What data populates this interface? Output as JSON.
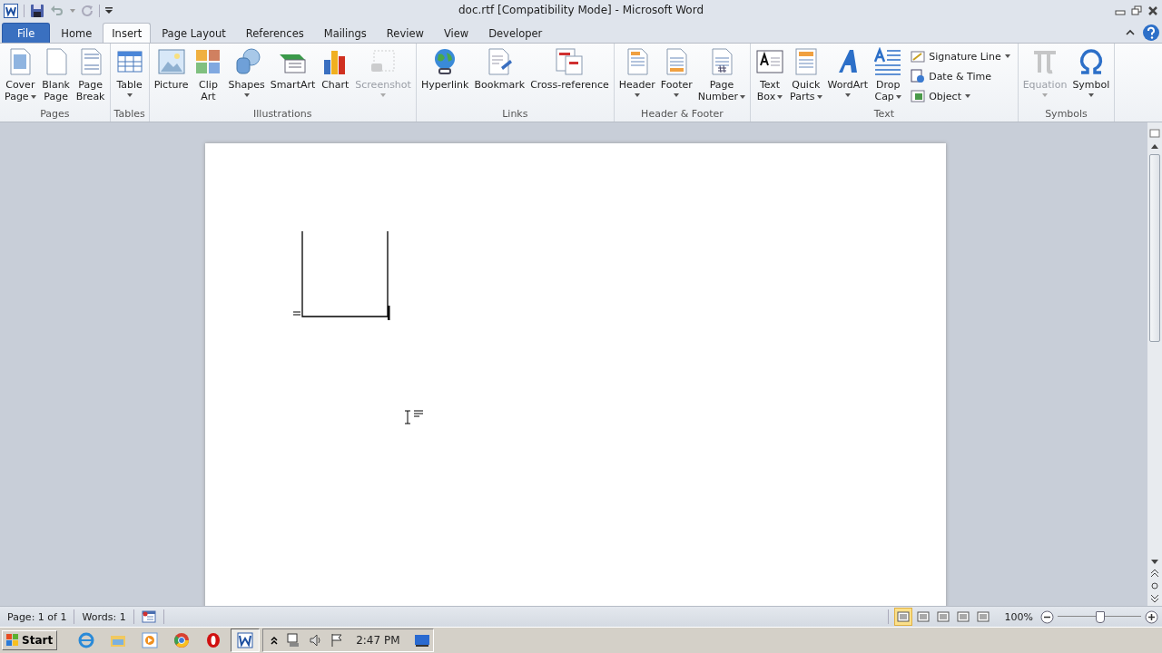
{
  "window": {
    "title": "doc.rtf [Compatibility Mode]  -  Microsoft Word"
  },
  "tabs": [
    {
      "label": "File",
      "kind": "file",
      "selected": false
    },
    {
      "label": "Home",
      "kind": "tab",
      "selected": false
    },
    {
      "label": "Insert",
      "kind": "tab",
      "selected": true
    },
    {
      "label": "Page Layout",
      "kind": "tab",
      "selected": false
    },
    {
      "label": "References",
      "kind": "tab",
      "selected": false
    },
    {
      "label": "Mailings",
      "kind": "tab",
      "selected": false
    },
    {
      "label": "Review",
      "kind": "tab",
      "selected": false
    },
    {
      "label": "View",
      "kind": "tab",
      "selected": false
    },
    {
      "label": "Developer",
      "kind": "tab",
      "selected": false
    }
  ],
  "ribbon_groups": [
    {
      "name": "Pages",
      "items": [
        {
          "kind": "large",
          "lines": [
            "Cover",
            "Page"
          ],
          "dropdown": true,
          "disabled": false
        },
        {
          "kind": "large",
          "lines": [
            "Blank",
            "Page"
          ],
          "dropdown": false,
          "disabled": false
        },
        {
          "kind": "large",
          "lines": [
            "Page",
            "Break"
          ],
          "dropdown": false,
          "disabled": false
        }
      ]
    },
    {
      "name": "Tables",
      "items": [
        {
          "kind": "large",
          "lines": [
            "Table"
          ],
          "dropdown": true,
          "disabled": false
        }
      ]
    },
    {
      "name": "Illustrations",
      "items": [
        {
          "kind": "large",
          "lines": [
            "Picture"
          ],
          "dropdown": false,
          "disabled": false
        },
        {
          "kind": "large",
          "lines": [
            "Clip",
            "Art"
          ],
          "dropdown": false,
          "disabled": false
        },
        {
          "kind": "large",
          "lines": [
            "Shapes"
          ],
          "dropdown": true,
          "disabled": false
        },
        {
          "kind": "large",
          "lines": [
            "SmartArt"
          ],
          "dropdown": false,
          "disabled": false
        },
        {
          "kind": "large",
          "lines": [
            "Chart"
          ],
          "dropdown": false,
          "disabled": false
        },
        {
          "kind": "large",
          "lines": [
            "Screenshot"
          ],
          "dropdown": true,
          "disabled": true
        }
      ]
    },
    {
      "name": "Links",
      "items": [
        {
          "kind": "large",
          "lines": [
            "Hyperlink"
          ],
          "dropdown": false,
          "disabled": false
        },
        {
          "kind": "large",
          "lines": [
            "Bookmark"
          ],
          "dropdown": false,
          "disabled": false
        },
        {
          "kind": "large",
          "lines": [
            "Cross-reference"
          ],
          "dropdown": false,
          "disabled": false
        }
      ]
    },
    {
      "name": "Header & Footer",
      "items": [
        {
          "kind": "large",
          "lines": [
            "Header"
          ],
          "dropdown": true,
          "disabled": false
        },
        {
          "kind": "large",
          "lines": [
            "Footer"
          ],
          "dropdown": true,
          "disabled": false
        },
        {
          "kind": "large",
          "lines": [
            "Page",
            "Number"
          ],
          "dropdown": true,
          "disabled": false
        }
      ]
    },
    {
      "name": "Text",
      "items": [
        {
          "kind": "large",
          "lines": [
            "Text",
            "Box"
          ],
          "dropdown": true,
          "disabled": false
        },
        {
          "kind": "large",
          "lines": [
            "Quick",
            "Parts"
          ],
          "dropdown": true,
          "disabled": false
        },
        {
          "kind": "large",
          "lines": [
            "WordArt"
          ],
          "dropdown": true,
          "disabled": false
        },
        {
          "kind": "large",
          "lines": [
            "Drop",
            "Cap"
          ],
          "dropdown": true,
          "disabled": false
        },
        {
          "kind": "small",
          "lines": [
            "Signature Line"
          ],
          "dropdown": true,
          "disabled": false
        },
        {
          "kind": "small",
          "lines": [
            "Date & Time"
          ],
          "dropdown": false,
          "disabled": false
        },
        {
          "kind": "small",
          "lines": [
            "Object"
          ],
          "dropdown": true,
          "disabled": false
        }
      ]
    },
    {
      "name": "Symbols",
      "items": [
        {
          "kind": "large",
          "lines": [
            "Equation"
          ],
          "dropdown": true,
          "disabled": true
        },
        {
          "kind": "large",
          "lines": [
            "Symbol"
          ],
          "dropdown": true,
          "disabled": false
        }
      ]
    }
  ],
  "status_bar": {
    "page": "Page: 1 of 1",
    "words": "Words: 1",
    "views": [
      {
        "selected": true
      },
      {
        "selected": false
      },
      {
        "selected": false
      },
      {
        "selected": false
      },
      {
        "selected": false
      }
    ],
    "zoom": "100%",
    "zoom_slider": {
      "level": 0.5
    }
  },
  "taskbar": {
    "start": "Start",
    "apps": [
      {
        "selected": false
      },
      {
        "selected": false
      },
      {
        "selected": false
      },
      {
        "selected": false
      },
      {
        "selected": false
      },
      {
        "selected": true
      }
    ],
    "clock": "2:47 PM"
  }
}
